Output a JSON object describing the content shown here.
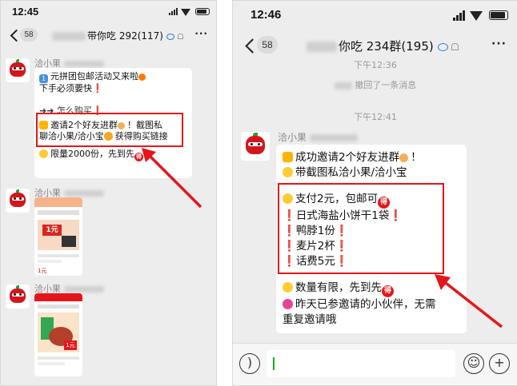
{
  "left": {
    "time": "12:45",
    "badge": "58",
    "title": "带你吃 292(117)",
    "sender": "洽小果",
    "msg": {
      "l1": "元拼团包邮活动又来啦",
      "l1_num": "1",
      "l2": "下手必须要快",
      "l3": "怎么购买",
      "box1": "邀请2个好友进群",
      "box1b": "！截图私",
      "box2a": "聊洽小果/洽小宝",
      "box2b": "获得购买链接",
      "last": "限量2000份，先到先"
    },
    "sender2": "洽小果",
    "sender3": "洽小果",
    "card1": {
      "tag": "洽小果",
      "promo": "1元",
      "btm": "1元"
    },
    "card2": {
      "tag": "洽小果",
      "promo": "1元"
    }
  },
  "right": {
    "time": "12:46",
    "badge": "58",
    "title": "你吃 234群(195)",
    "sys_time1": "下午12:36",
    "sys_recall": "撤回了一条消息",
    "sys_time2": "下午12:41",
    "sender": "洽小果",
    "msg": {
      "l1": "成功邀请2个好友进群",
      "l1b": "！",
      "l2": "带截图私洽小果/洽小宝",
      "b1": "支付2元，包邮可",
      "b2": "日式海盐小饼干1袋",
      "b3": "鸭脖1份",
      "b4": "麦片2杯",
      "b5": "话费5元",
      "t1": "数量有限，先到先",
      "t2": "昨天已参邀请的小伙伴，无需",
      "t3": "重复邀请哦"
    },
    "de": "得"
  },
  "colors": {
    "accent_red": "#e4161b",
    "chat_bg": "#ededed",
    "green_caret": "#1aad19"
  },
  "icons": [
    "back-chevron-icon",
    "more-dots-icon",
    "signal-icon",
    "wifi-icon",
    "battery-icon",
    "voice-icon",
    "emoji-icon",
    "plus-icon"
  ]
}
